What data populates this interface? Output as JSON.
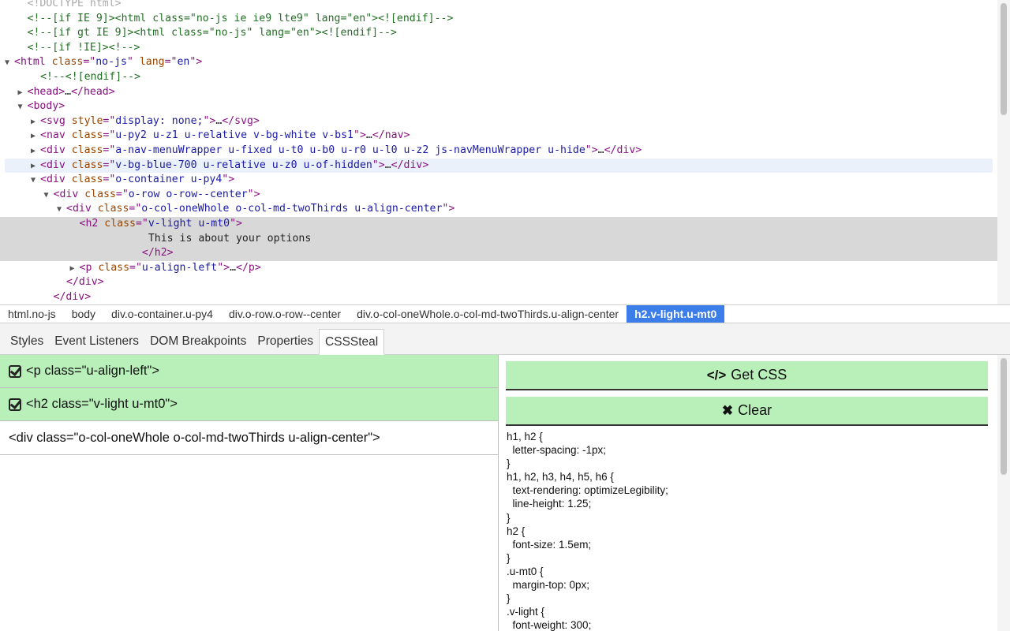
{
  "dom_tree": {
    "lines": [
      {
        "indent": 1,
        "toggle": "",
        "state": "",
        "parts": [
          {
            "c": "faded",
            "t": "<!DOCTYPE html>"
          }
        ]
      },
      {
        "indent": 1,
        "toggle": "",
        "state": "",
        "parts": [
          {
            "c": "cmt",
            "t": "<!--[if IE 9]><html class=\"no-js ie ie9 lte9\" lang=\"en\"><![endif]-->"
          }
        ]
      },
      {
        "indent": 1,
        "toggle": "",
        "state": "",
        "parts": [
          {
            "c": "cmt",
            "t": "<!--[if gt IE 9]><html class=\"no-js\" lang=\"en\"><![endif]-->"
          }
        ]
      },
      {
        "indent": 1,
        "toggle": "",
        "state": "",
        "parts": [
          {
            "c": "cmt",
            "t": "<!--[if !IE]><!-->"
          }
        ]
      },
      {
        "indent": 0,
        "toggle": "▼",
        "state": "",
        "parts": [
          {
            "c": "tag",
            "t": "<html "
          },
          {
            "c": "attr",
            "t": "class"
          },
          {
            "c": "tag",
            "t": "=\""
          },
          {
            "c": "val",
            "t": "no-js"
          },
          {
            "c": "tag",
            "t": "\" "
          },
          {
            "c": "attr",
            "t": "lang"
          },
          {
            "c": "tag",
            "t": "=\""
          },
          {
            "c": "val",
            "t": "en"
          },
          {
            "c": "tag",
            "t": "\">"
          }
        ]
      },
      {
        "indent": 2,
        "toggle": "",
        "state": "",
        "parts": [
          {
            "c": "cmt",
            "t": "<!--<![endif]-->"
          }
        ]
      },
      {
        "indent": 1,
        "toggle": "▶",
        "state": "",
        "parts": [
          {
            "c": "tag",
            "t": "<head>"
          },
          {
            "c": "txt",
            "t": "…"
          },
          {
            "c": "tag",
            "t": "</head>"
          }
        ]
      },
      {
        "indent": 1,
        "toggle": "▼",
        "state": "",
        "parts": [
          {
            "c": "tag",
            "t": "<body>"
          }
        ]
      },
      {
        "indent": 2,
        "toggle": "▶",
        "state": "",
        "parts": [
          {
            "c": "tag",
            "t": "<svg "
          },
          {
            "c": "attr",
            "t": "style"
          },
          {
            "c": "tag",
            "t": "=\""
          },
          {
            "c": "val",
            "t": "display: none;"
          },
          {
            "c": "tag",
            "t": "\">"
          },
          {
            "c": "txt",
            "t": "…"
          },
          {
            "c": "tag",
            "t": "</svg>"
          }
        ]
      },
      {
        "indent": 2,
        "toggle": "▶",
        "state": "",
        "parts": [
          {
            "c": "tag",
            "t": "<nav "
          },
          {
            "c": "attr",
            "t": "class"
          },
          {
            "c": "tag",
            "t": "=\""
          },
          {
            "c": "val",
            "t": "u-py2 u-z1 u-relative v-bg-white v-bs1"
          },
          {
            "c": "tag",
            "t": "\">"
          },
          {
            "c": "txt",
            "t": "…"
          },
          {
            "c": "tag",
            "t": "</nav>"
          }
        ]
      },
      {
        "indent": 2,
        "toggle": "▶",
        "state": "",
        "parts": [
          {
            "c": "tag",
            "t": "<div "
          },
          {
            "c": "attr",
            "t": "class"
          },
          {
            "c": "tag",
            "t": "=\""
          },
          {
            "c": "val",
            "t": "a-nav-menuWrapper u-fixed u-t0 u-b0 u-r0 u-l0 u-z2 js-navMenuWrapper u-hide"
          },
          {
            "c": "tag",
            "t": "\">"
          },
          {
            "c": "txt",
            "t": "…"
          },
          {
            "c": "tag",
            "t": "</div>"
          }
        ]
      },
      {
        "indent": 2,
        "toggle": "▶",
        "state": "hover",
        "parts": [
          {
            "c": "tag",
            "t": "<div "
          },
          {
            "c": "attr",
            "t": "class"
          },
          {
            "c": "tag",
            "t": "=\""
          },
          {
            "c": "val",
            "t": "v-bg-blue-700 u-relative u-z0 u-of-hidden"
          },
          {
            "c": "tag",
            "t": "\">"
          },
          {
            "c": "txt",
            "t": "…"
          },
          {
            "c": "tag",
            "t": "</div>"
          }
        ]
      },
      {
        "indent": 2,
        "toggle": "▼",
        "state": "",
        "parts": [
          {
            "c": "tag",
            "t": "<div "
          },
          {
            "c": "attr",
            "t": "class"
          },
          {
            "c": "tag",
            "t": "=\""
          },
          {
            "c": "val",
            "t": "o-container u-py4"
          },
          {
            "c": "tag",
            "t": "\">"
          }
        ]
      },
      {
        "indent": 3,
        "toggle": "▼",
        "state": "",
        "parts": [
          {
            "c": "tag",
            "t": "<div "
          },
          {
            "c": "attr",
            "t": "class"
          },
          {
            "c": "tag",
            "t": "=\""
          },
          {
            "c": "val",
            "t": "o-row o-row--center"
          },
          {
            "c": "tag",
            "t": "\">"
          }
        ]
      },
      {
        "indent": 4,
        "toggle": "▼",
        "state": "",
        "parts": [
          {
            "c": "tag",
            "t": "<div "
          },
          {
            "c": "attr",
            "t": "class"
          },
          {
            "c": "tag",
            "t": "=\""
          },
          {
            "c": "val",
            "t": "o-col-oneWhole o-col-md-twoThirds u-align-center"
          },
          {
            "c": "tag",
            "t": "\">"
          }
        ]
      },
      {
        "indent": 5,
        "toggle": "",
        "state": "sel",
        "parts": [
          {
            "c": "tag",
            "t": "<h2 "
          },
          {
            "c": "attr",
            "t": "class"
          },
          {
            "c": "tag",
            "t": "=\""
          },
          {
            "c": "val",
            "t": "v-light u-mt0"
          },
          {
            "c": "tag",
            "t": "\">"
          }
        ]
      },
      {
        "indent": 5,
        "toggle": "",
        "state": "sel",
        "parts": [
          {
            "c": "txt",
            "t": "           This is about your options"
          }
        ]
      },
      {
        "indent": 5,
        "toggle": "",
        "state": "sel",
        "parts": [
          {
            "c": "tag",
            "t": "          </h2>"
          }
        ]
      },
      {
        "indent": 5,
        "toggle": "▶",
        "state": "",
        "parts": [
          {
            "c": "tag",
            "t": "<p "
          },
          {
            "c": "attr",
            "t": "class"
          },
          {
            "c": "tag",
            "t": "=\""
          },
          {
            "c": "val",
            "t": "u-align-left"
          },
          {
            "c": "tag",
            "t": "\">"
          },
          {
            "c": "txt",
            "t": "…"
          },
          {
            "c": "tag",
            "t": "</p>"
          }
        ]
      },
      {
        "indent": 4,
        "toggle": "",
        "state": "",
        "parts": [
          {
            "c": "tag",
            "t": "</div>"
          }
        ]
      },
      {
        "indent": 3,
        "toggle": "",
        "state": "",
        "parts": [
          {
            "c": "tag",
            "t": "</div>"
          }
        ]
      }
    ]
  },
  "breadcrumbs": [
    {
      "label": "html.no-js",
      "active": false
    },
    {
      "label": "body",
      "active": false
    },
    {
      "label": "div.o-container.u-py4",
      "active": false
    },
    {
      "label": "div.o-row.o-row--center",
      "active": false
    },
    {
      "label": "div.o-col-oneWhole.o-col-md-twoThirds.u-align-center",
      "active": false
    },
    {
      "label": "h2.v-light.u-mt0",
      "active": true
    }
  ],
  "tabs": [
    {
      "label": "Styles",
      "active": false
    },
    {
      "label": "Event Listeners",
      "active": false
    },
    {
      "label": "DOM Breakpoints",
      "active": false
    },
    {
      "label": "Properties",
      "active": false
    },
    {
      "label": "CSSSteal",
      "active": true
    }
  ],
  "css_steal": {
    "elements": [
      {
        "label": "<p class=\"u-align-left\">",
        "checked": true
      },
      {
        "label": "<h2 class=\"v-light u-mt0\">",
        "checked": true
      },
      {
        "label": "<div class=\"o-col-oneWhole o-col-md-twoThirds u-align-center\">",
        "checked": false
      }
    ],
    "get_css": {
      "icon": "</>",
      "label": "Get CSS"
    },
    "clear": {
      "icon": "✖",
      "label": "Clear"
    },
    "output_lines": [
      "h1, h2 {",
      "  letter-spacing: -1px;",
      "}",
      "h1, h2, h3, h4, h5, h6 {",
      "  text-rendering: optimizeLegibility;",
      "  line-height: 1.25;",
      "}",
      "h2 {",
      "  font-size: 1.5em;",
      "}",
      ".u-mt0 {",
      "  margin-top: 0px;",
      "}",
      ".v-light {",
      "  font-weight: 300;"
    ]
  },
  "colors": {
    "accent_blue": "#3b7de9",
    "steal_green": "#b9f0b9",
    "selected_row": "#d8d8d8",
    "hover_row": "#eaf1fb"
  }
}
